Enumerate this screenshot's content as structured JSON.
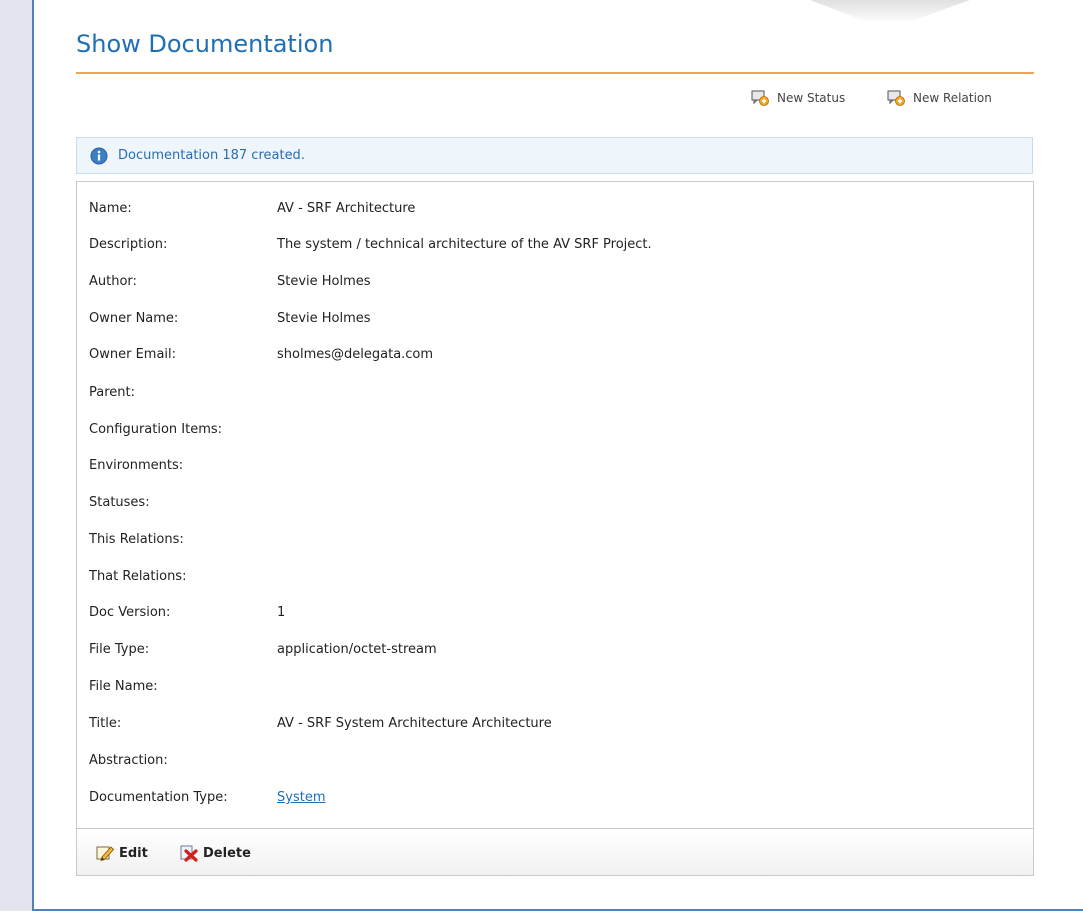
{
  "page": {
    "title": "Show Documentation"
  },
  "actions": {
    "new_status": "New Status",
    "new_relation": "New Relation"
  },
  "notice": {
    "message": "Documentation 187 created."
  },
  "fields": [
    {
      "label": "Name:",
      "value": "AV - SRF Architecture"
    },
    {
      "label": "Description:",
      "value": "The system / technical architecture of the AV SRF Project."
    },
    {
      "label": "Author:",
      "value": "Stevie Holmes"
    },
    {
      "label": "Owner Name:",
      "value": "Stevie Holmes"
    },
    {
      "label": "Owner Email:",
      "value": "sholmes@delegata.com"
    },
    {
      "label": "Parent:",
      "value": ""
    },
    {
      "label": "Configuration Items:",
      "value": ""
    },
    {
      "label": "Environments:",
      "value": ""
    },
    {
      "label": "Statuses:",
      "value": ""
    },
    {
      "label": "This Relations:",
      "value": ""
    },
    {
      "label": "That Relations:",
      "value": ""
    },
    {
      "label": "Doc Version:",
      "value": "1"
    },
    {
      "label": "File Type:",
      "value": "application/octet-stream"
    },
    {
      "label": "File Name:",
      "value": ""
    },
    {
      "label": "Title:",
      "value": "AV - SRF System Architecture Architecture"
    },
    {
      "label": "Abstraction:",
      "value": ""
    },
    {
      "label": "Documentation Type:",
      "value": "System"
    }
  ],
  "toolbar": {
    "edit_label": "Edit",
    "delete_label": "Delete"
  },
  "colors": {
    "title": "#1f6fb5",
    "rule": "#f0a45a",
    "link": "#1f6fb5",
    "notice_bg": "#eef5fb"
  },
  "icons": {
    "new_status": "comment-add-icon",
    "new_relation": "comment-add-icon",
    "notice": "info-icon",
    "edit": "pencil-icon",
    "delete": "red-x-icon"
  }
}
